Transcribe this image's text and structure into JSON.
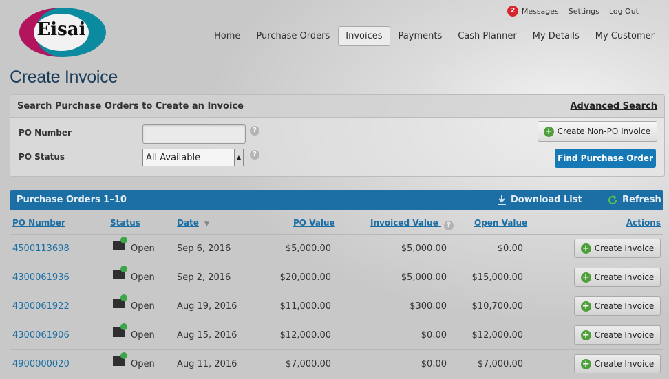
{
  "brand": {
    "logo_text": "Eisai",
    "colors": {
      "magenta": "#b3145e",
      "teal": "#0b8aa0",
      "primary": "#1679b6",
      "header": "#1b6fa4"
    }
  },
  "utility": {
    "messages_count": "2",
    "messages_label": "Messages",
    "settings_label": "Settings",
    "logout_label": "Log Out"
  },
  "nav": [
    "Home",
    "Purchase Orders",
    "Invoices",
    "Payments",
    "Cash Planner",
    "My Details",
    "My Customer"
  ],
  "nav_active": "Invoices",
  "page_title": "Create Invoice",
  "search": {
    "heading": "Search Purchase Orders to Create an Invoice",
    "advanced_link": "Advanced Search",
    "po_number_label": "PO Number",
    "po_number_value": "",
    "po_status_label": "PO Status",
    "po_status_value": "All Available",
    "help_glyph": "?",
    "create_non_po_label": "Create Non-PO Invoice",
    "find_label": "Find Purchase Order"
  },
  "results": {
    "title": "Purchase Orders 1–10",
    "download_label": "Download List",
    "refresh_label": "Refresh",
    "columns": {
      "po_number": "PO Number",
      "status": "Status",
      "date": "Date",
      "po_value": "PO Value",
      "invoiced_value": "Invoiced Value",
      "open_value": "Open Value",
      "actions": "Actions"
    },
    "action_label": "Create Invoice",
    "rows": [
      {
        "po": "4500113698",
        "status": "Open",
        "date": "Sep 6, 2016",
        "po_value": "$5,000.00",
        "invoiced": "$5,000.00",
        "open": "$0.00"
      },
      {
        "po": "4300061936",
        "status": "Open",
        "date": "Sep 2, 2016",
        "po_value": "$20,000.00",
        "invoiced": "$5,000.00",
        "open": "$15,000.00"
      },
      {
        "po": "4300061922",
        "status": "Open",
        "date": "Aug 19, 2016",
        "po_value": "$11,000.00",
        "invoiced": "$300.00",
        "open": "$10,700.00"
      },
      {
        "po": "4300061906",
        "status": "Open",
        "date": "Aug 15, 2016",
        "po_value": "$12,000.00",
        "invoiced": "$0.00",
        "open": "$12,000.00"
      },
      {
        "po": "4900000020",
        "status": "Open",
        "date": "Aug 11, 2016",
        "po_value": "$7,000.00",
        "invoiced": "$0.00",
        "open": "$7,000.00"
      }
    ]
  }
}
